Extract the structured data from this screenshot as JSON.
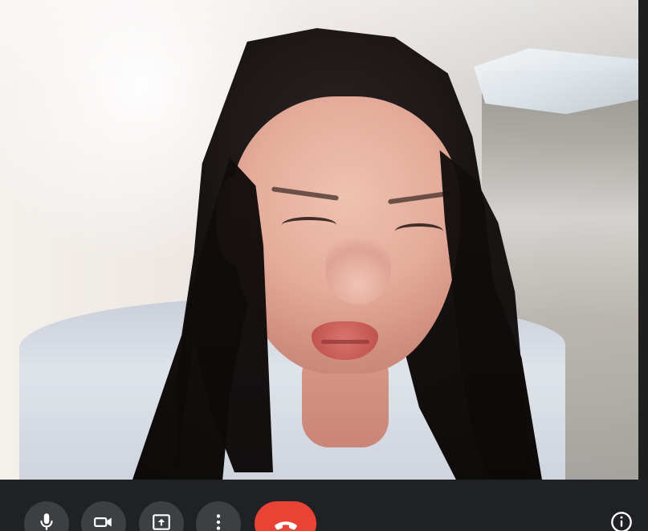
{
  "meeting": {
    "participant_video": "camera-feed"
  },
  "controls": {
    "mic_icon": "microphone-icon",
    "camera_icon": "video-camera-icon",
    "present_icon": "present-screen-icon",
    "more_icon": "more-vertical-icon",
    "leave_icon": "call-end-icon",
    "info_icon": "info-icon"
  },
  "colors": {
    "control_bar": "#202124",
    "control_button": "#3c4043",
    "leave_button": "#ea4335",
    "icon": "#ffffff"
  }
}
